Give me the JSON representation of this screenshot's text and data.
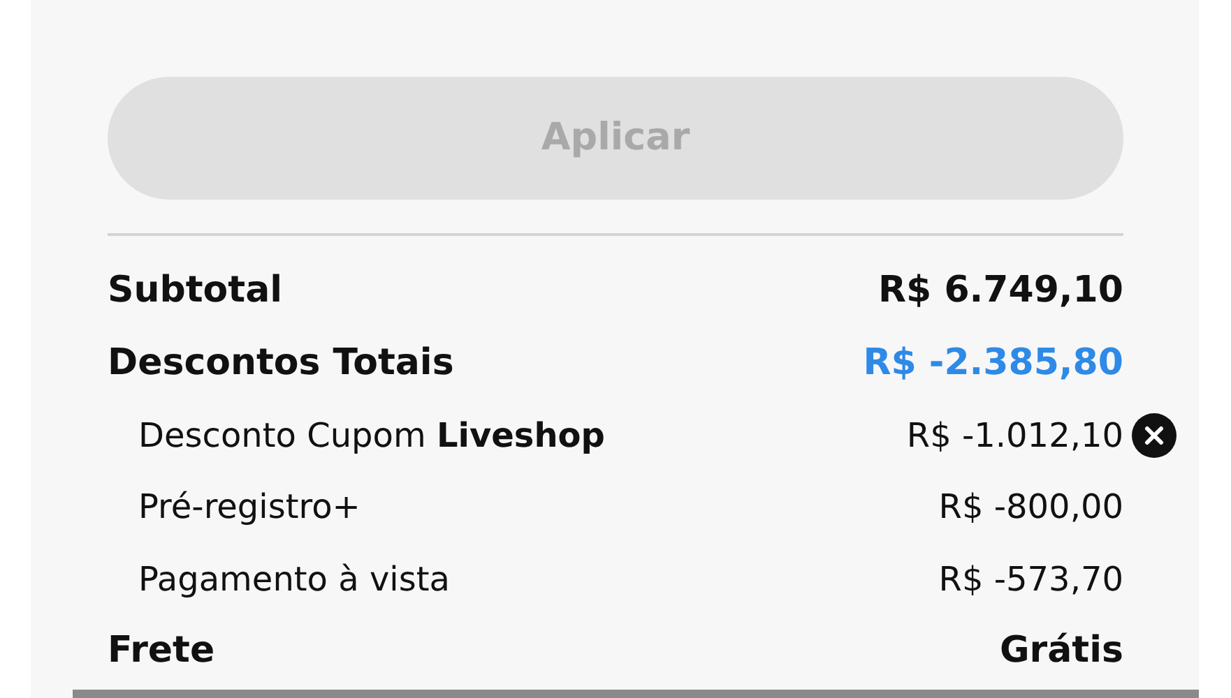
{
  "apply_button": {
    "label": "Aplicar",
    "disabled": true
  },
  "summary": [
    {
      "kind": "total",
      "label": "Subtotal",
      "value": "R$ 6.749,10",
      "highlight": false
    },
    {
      "kind": "total",
      "label": "Descontos Totais",
      "value": "R$ -2.385,80",
      "highlight": true
    },
    {
      "kind": "detail",
      "label": "Desconto Cupom **Liveshop**",
      "value": "R$ -1.012,10",
      "removable": true
    },
    {
      "kind": "detail",
      "label": "Pré-registro+",
      "value": "R$ -800,00",
      "removable": false
    },
    {
      "kind": "detail",
      "label": "Pagamento à vista",
      "value": "R$ -573,70",
      "removable": false
    },
    {
      "kind": "total",
      "label": "Frete",
      "value": "Grátis",
      "highlight": false
    }
  ]
}
